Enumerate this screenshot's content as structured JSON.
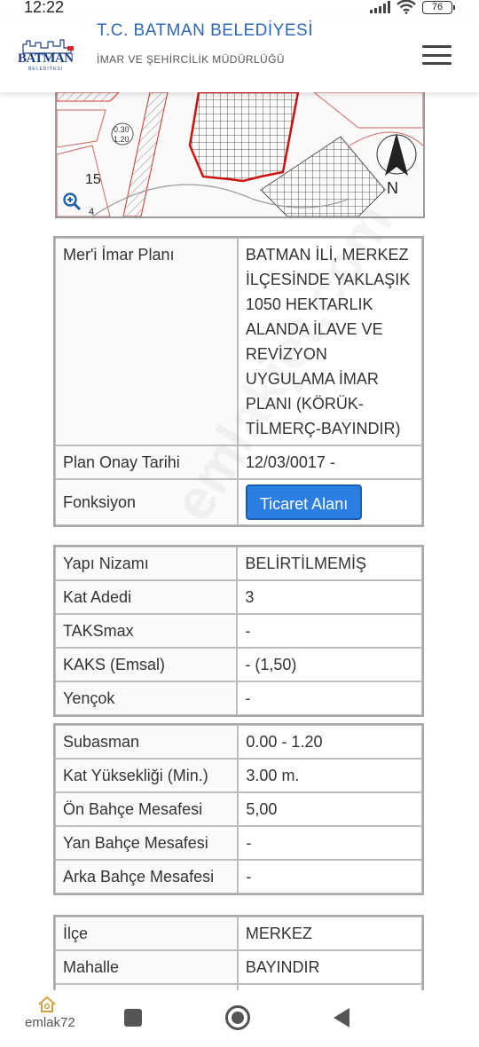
{
  "status_bar": {
    "time": "12:22",
    "battery": "76"
  },
  "header": {
    "logo_text": "BATMAN",
    "logo_subtext": "BELEDİYESİ",
    "title": "T.C. BATMAN BELEDİYESİ",
    "subtitle": "İMAR VE ŞEHİRCİLİK MÜDÜRLÜĞÜ"
  },
  "map": {
    "labels": [
      "0.30",
      "1.20",
      "15",
      "4",
      "N"
    ]
  },
  "plan_table": [
    {
      "key": "Mer'i İmar Planı",
      "value_lines": [
        "BATMAN İLİ, MERKEZ",
        "İLÇESİNDE YAKLAŞIK",
        "1050 HEKTARLIK",
        "ALANDA İLAVE VE",
        "REVİZYON",
        "UYGULAMA İMAR",
        "PLANI (KÖRÜK-",
        "TİLMERÇ-BAYINDIR)"
      ]
    },
    {
      "key": "Plan Onay Tarihi",
      "value": "12/03/0017 -"
    },
    {
      "key": "Fonksiyon",
      "button": "Ticaret Alanı"
    }
  ],
  "build_table": [
    {
      "key": "Yapı Nizamı",
      "value": "BELİRTİLMEMİŞ"
    },
    {
      "key": "Kat Adedi",
      "value": "3"
    },
    {
      "key": "TAKSmax",
      "value": "-"
    },
    {
      "key": "KAKS (Emsal)",
      "value": "- (1,50)"
    },
    {
      "key": "Yençok",
      "value": "-"
    }
  ],
  "distance_table": [
    {
      "key": "Subasman",
      "value": "0.00 - 1.20"
    },
    {
      "key": "Kat Yüksekliği (Min.)",
      "value": "3.00 m."
    },
    {
      "key": "Ön Bahçe Mesafesi",
      "value": "5,00"
    },
    {
      "key": "Yan Bahçe Mesafesi",
      "value": "-"
    },
    {
      "key": "Arka Bahçe Mesafesi",
      "value": "-"
    }
  ],
  "location_table": [
    {
      "key": "İlçe",
      "value": "MERKEZ"
    },
    {
      "key": "Mahalle",
      "value": "BAYINDIR"
    }
  ],
  "watermark": "emlakjet.com",
  "nav_bar": {
    "emlak_logo": "emlak72"
  }
}
